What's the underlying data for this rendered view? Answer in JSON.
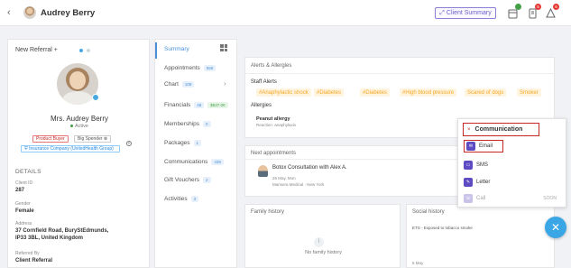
{
  "header": {
    "back_icon": "chevron-left-icon",
    "patient_name": "Audrey Berry",
    "client_summary_label": "Client Summary",
    "notification_badges": [
      "",
      "5",
      "6"
    ]
  },
  "profile": {
    "new_referral_label": "New Referral +",
    "full_name": "Mrs. Audrey Berry",
    "status": "Active",
    "tags": [
      "Product Buyer",
      "Big Spender"
    ],
    "insurance": "Insurance Company (UnitedHealth Group)",
    "details_heading": "DETAILS",
    "fields": [
      {
        "label": "Client ID",
        "value": "287"
      },
      {
        "label": "Gender",
        "value": "Female"
      },
      {
        "label": "Address",
        "value": "37 Cornfield Road, BuryStEdmunds, IP33 3BL, United Kingdom"
      },
      {
        "label": "Referred By",
        "value": "Client Referral"
      }
    ]
  },
  "nav": {
    "items": [
      {
        "label": "Summary",
        "count": ""
      },
      {
        "label": "Appointments",
        "count": "559"
      },
      {
        "label": "Chart",
        "count": "109"
      },
      {
        "label": "Financials",
        "count": "48",
        "extra": "$637.00"
      },
      {
        "label": "Memberships",
        "count": "0"
      },
      {
        "label": "Packages",
        "count": "1"
      },
      {
        "label": "Communications",
        "count": "439"
      },
      {
        "label": "Gift Vouchers",
        "count": "2"
      },
      {
        "label": "Activities",
        "count": "3"
      }
    ]
  },
  "alerts": {
    "title": "Alerts & Allergies",
    "staff_alerts_label": "Staff Alerts",
    "staff_alerts": [
      "#Anaphylactic shock",
      "#Diabetes",
      "#Diabetes",
      "#High blood pressure",
      "Scared of dogs",
      "Smoker"
    ],
    "allergies_label": "Allergies",
    "allergy_name": "Peanut allergy",
    "allergy_reaction": "Reaction: anaphylaxis"
  },
  "appointments": {
    "title": "Next appointments",
    "name": "Botox Consultation with Alex A.",
    "date": "26 May, Mon",
    "location": "Mansera Medical · New York"
  },
  "family": {
    "title": "Family history",
    "empty": "No family history"
  },
  "social": {
    "title": "Social history",
    "entry": "ETS - Exposed to tobacco smoke",
    "date": "5 May"
  },
  "communication": {
    "title": "Communication",
    "items": [
      {
        "label": "Email",
        "icon": "email-icon"
      },
      {
        "label": "SMS",
        "icon": "sms-icon"
      },
      {
        "label": "Letter",
        "icon": "letter-icon"
      },
      {
        "label": "Call",
        "icon": "phone-icon",
        "badge": "SOON"
      }
    ]
  },
  "colors": {
    "accent": "#3ba6e6",
    "purple": "#5c4bc2",
    "highlight": "#c62828",
    "alert_tag": "#f5a623"
  }
}
